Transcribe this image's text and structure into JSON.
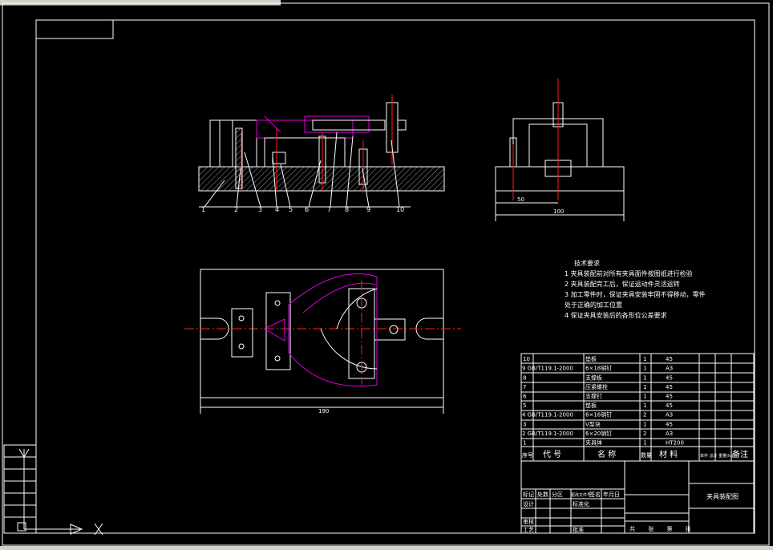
{
  "drawing": {
    "part_labels": [
      "1",
      "2",
      "3",
      "4",
      "5",
      "6",
      "7",
      "8",
      "9",
      "10"
    ],
    "dimensions": {
      "side_dim_50": "50",
      "side_dim_100": "100",
      "plan_dim_190": "190"
    },
    "tech_requirements": {
      "title": "技术要求",
      "items": [
        "1  夹具装配前对所有夹具面件按图纸进行检验",
        "2  夹具装配完工后，保证运动件灵活运转",
        "3  加工零件时，保证夹具安装牢固不得移动，零件",
        "    处于正确的加工位置",
        "4  保证夹具安装后的各形位公差要求"
      ]
    },
    "bom": {
      "rows": [
        {
          "no": "10",
          "code": "",
          "name": "垫板",
          "qty": "1",
          "material": "45"
        },
        {
          "no": "9",
          "code": "GB/T119.1-2000",
          "name": "6×18销钉",
          "qty": "1",
          "material": "A3"
        },
        {
          "no": "8",
          "code": "",
          "name": "支撑板",
          "qty": "1",
          "material": "45"
        },
        {
          "no": "7",
          "code": "",
          "name": "压紧螺栓",
          "qty": "1",
          "material": "45"
        },
        {
          "no": "6",
          "code": "",
          "name": "支撑钉",
          "qty": "1",
          "material": "45"
        },
        {
          "no": "5",
          "code": "",
          "name": "垫板",
          "qty": "1",
          "material": "45"
        },
        {
          "no": "4",
          "code": "GB/T119.1-2000",
          "name": "6×16销钉",
          "qty": "2",
          "material": "A3"
        },
        {
          "no": "3",
          "code": "",
          "name": "V型块",
          "qty": "1",
          "material": "45"
        },
        {
          "no": "2",
          "code": "GB/T119.1-2000",
          "name": "6×20销钉",
          "qty": "2",
          "material": "A3"
        },
        {
          "no": "1",
          "code": "",
          "name": "夹具体",
          "qty": "1",
          "material": "HT200"
        }
      ],
      "header": {
        "no": "序号",
        "code": "代 号",
        "name": "名 称",
        "qty": "数量",
        "material": "材 料",
        "weight": "单件 总计 重量(kg)",
        "remark": "备注"
      }
    },
    "title_block": {
      "drawing_title": "夹具装配图",
      "row_labels": [
        "标记",
        "处数",
        "分区",
        "更改文件号",
        "签名",
        "年月日"
      ],
      "design": "设计",
      "standard": "标准化",
      "check": "审核",
      "process": "工艺",
      "approve": "批准",
      "scale_row": "共 张 第 张"
    },
    "colors": {
      "background": "#000000",
      "line": "#ffffff",
      "center": "#ff2020",
      "accent": "#e000e0"
    }
  }
}
